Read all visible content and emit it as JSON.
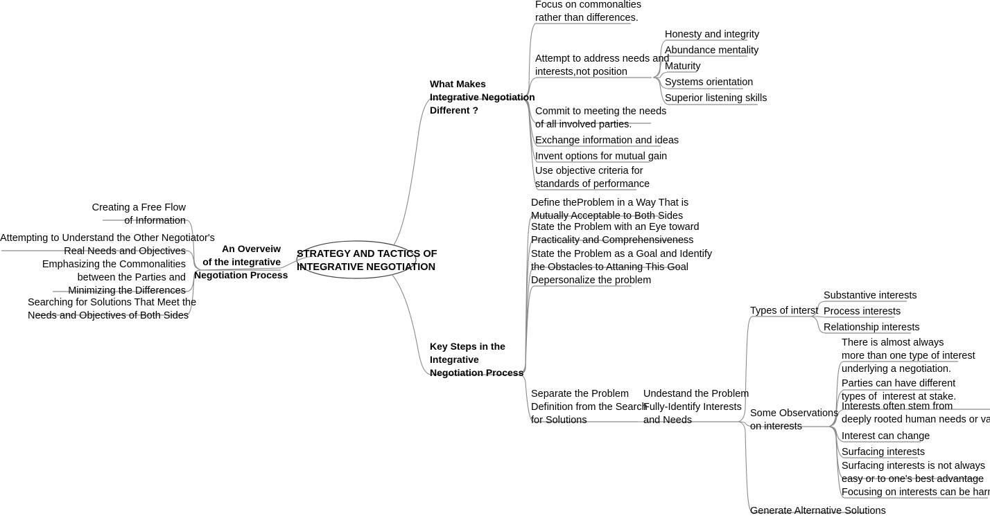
{
  "diagram": {
    "type": "mind-map",
    "title": "STRATEGY AND TACTICS OF INTEGRATIVE NEGOTIATION",
    "colors": {
      "text": "#000000",
      "link": "#888888",
      "background": "#ffffff",
      "node_outline": "#000000"
    },
    "root": {
      "label_line1": "STRATEGY AND TACTICS OF",
      "label_line2": "INTEGRATIVE NEGOTIATION",
      "shape": "ellipse"
    },
    "branches": [
      {
        "id": "what-makes-different",
        "label": "What Makes\nIntegrative Negotiation\nDifferent ?",
        "side": "right",
        "children": [
          {
            "id": "focus-commonalties",
            "label": "Focus on commonalties\nrather than differences."
          },
          {
            "id": "address-needs",
            "label": "Attempt to address needs and\ninterests,not position",
            "children": [
              {
                "id": "honesty-integrity",
                "label": "Honesty and integrity"
              },
              {
                "id": "abundance-mentality",
                "label": "Abundance mentality"
              },
              {
                "id": "maturity",
                "label": "Maturity"
              },
              {
                "id": "systems-orientation",
                "label": "Systems orientation"
              },
              {
                "id": "superior-listening",
                "label": "Superior listening skills"
              }
            ]
          },
          {
            "id": "commit-needs",
            "label": "Commit to meeting the needs\nof all involved parties."
          },
          {
            "id": "exchange-info",
            "label": "Exchange information and ideas"
          },
          {
            "id": "invent-options",
            "label": "Invent options for mutual gain"
          },
          {
            "id": "objective-criteria",
            "label": "Use objective criteria for\nstandards of performance"
          }
        ]
      },
      {
        "id": "overview",
        "label": "An Overveiw\nof the integrative\nNegotiation Process",
        "side": "left",
        "children": [
          {
            "id": "free-flow",
            "label": "Creating a Free Flow\nof Information"
          },
          {
            "id": "understand-other",
            "label": "Attempting to Understand the Other Negotiator's\nReal Needs and Objectives"
          },
          {
            "id": "emphasize-commonalities",
            "label": "Emphasizing the Commonalities\nbetween the Parties and\nMinimizing the Differences"
          },
          {
            "id": "search-solutions",
            "label": "Searching for Solutions That Meet the\nNeeds and Objectives of Both Sides"
          }
        ]
      },
      {
        "id": "key-steps",
        "label": "Key Steps in the\nIntegrative\nNegotiation Process",
        "side": "right",
        "children": [
          {
            "id": "define-problem",
            "label": "Define theProblem in a Way That is\nMutually Acceptable to Both Sides"
          },
          {
            "id": "state-problem-eye",
            "label": "State the Problem with an Eye toward\nPracticality and Comprehensiveness"
          },
          {
            "id": "state-problem-goal",
            "label": "State the Problem as a Goal and Identify\nthe Obstacles to Attaning This Goal"
          },
          {
            "id": "depersonalize",
            "label": "Depersonalize the problem"
          },
          {
            "id": "separate-definition",
            "label": "Separate the Problem\nDefinition from the Search\nfor Solutions",
            "children": [
              {
                "id": "understand-fully",
                "label": "Undestand the Problem\nFully-Identify Interests\nand Needs",
                "children": [
                  {
                    "id": "types-of-interest",
                    "label": "Types of interst",
                    "children": [
                      {
                        "id": "substantive-interests",
                        "label": "Substantive interests"
                      },
                      {
                        "id": "process-interests",
                        "label": "Process interests"
                      },
                      {
                        "id": "relationship-interests",
                        "label": "Relationship interests"
                      }
                    ]
                  },
                  {
                    "id": "some-observations",
                    "label": "Some Observations\non interests",
                    "children": [
                      {
                        "id": "almost-always",
                        "label": "There is almost always\nmore than one type of interest\nunderlying a negotiation."
                      },
                      {
                        "id": "parties-different",
                        "label": "Parties can have different\ntypes of  interest at stake."
                      },
                      {
                        "id": "deeply-rooted",
                        "label": "Interests often stem from\ndeeply rooted human needs or values."
                      },
                      {
                        "id": "interest-change",
                        "label": "Interest can change"
                      },
                      {
                        "id": "surfacing-interests",
                        "label": "Surfacing interests"
                      },
                      {
                        "id": "surfacing-not-easy",
                        "label": "Surfacing interests is not always\neasy or to one's best advantage"
                      },
                      {
                        "id": "focusing-harmful",
                        "label": "Focusing on interests can be harmful"
                      }
                    ]
                  },
                  {
                    "id": "generate-alternatives",
                    "label": "Generate Alternative Solutions"
                  }
                ]
              }
            ]
          }
        ]
      }
    ]
  }
}
